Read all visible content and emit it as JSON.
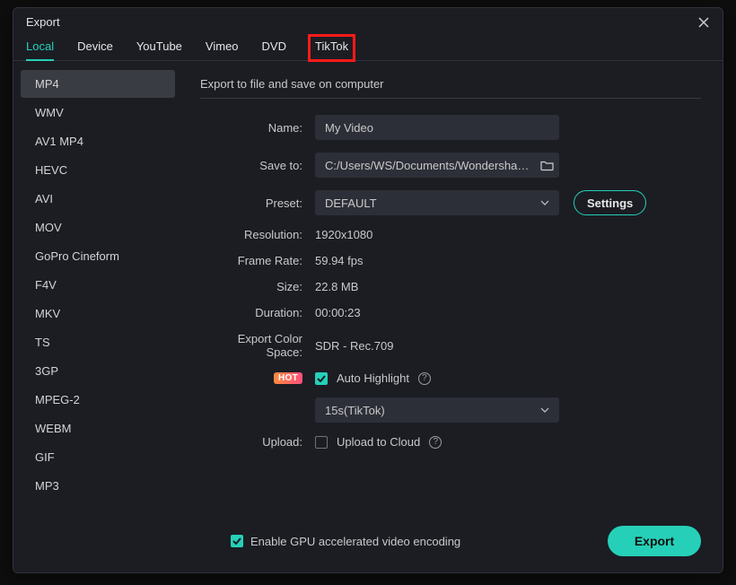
{
  "dialog": {
    "title": "Export",
    "tabs": [
      {
        "label": "Local",
        "active": true
      },
      {
        "label": "Device"
      },
      {
        "label": "YouTube"
      },
      {
        "label": "Vimeo"
      },
      {
        "label": "DVD"
      },
      {
        "label": "TikTok",
        "highlighted": true
      }
    ]
  },
  "sidebar": {
    "items": [
      {
        "label": "MP4",
        "active": true
      },
      {
        "label": "WMV"
      },
      {
        "label": "AV1 MP4"
      },
      {
        "label": "HEVC"
      },
      {
        "label": "AVI"
      },
      {
        "label": "MOV"
      },
      {
        "label": "GoPro Cineform"
      },
      {
        "label": "F4V"
      },
      {
        "label": "MKV"
      },
      {
        "label": "TS"
      },
      {
        "label": "3GP"
      },
      {
        "label": "MPEG-2"
      },
      {
        "label": "WEBM"
      },
      {
        "label": "GIF"
      },
      {
        "label": "MP3"
      }
    ]
  },
  "form": {
    "heading": "Export to file and save on computer",
    "name_label": "Name:",
    "name_value": "My Video",
    "save_to_label": "Save to:",
    "save_to_value": "C:/Users/WS/Documents/Wondershare/W",
    "preset_label": "Preset:",
    "preset_value": "DEFAULT",
    "settings_btn": "Settings",
    "resolution_label": "Resolution:",
    "resolution_value": "1920x1080",
    "frame_rate_label": "Frame Rate:",
    "frame_rate_value": "59.94 fps",
    "size_label": "Size:",
    "size_value": "22.8 MB",
    "duration_label": "Duration:",
    "duration_value": "00:00:23",
    "color_space_label": "Export Color Space:",
    "color_space_value": "SDR - Rec.709",
    "hot_badge": "HOT",
    "auto_highlight_label": "Auto Highlight",
    "highlight_preset_value": "15s(TikTok)",
    "upload_label": "Upload:",
    "upload_checkbox_label": "Upload to Cloud"
  },
  "footer": {
    "gpu_label": "Enable GPU accelerated video encoding",
    "export_btn": "Export"
  }
}
